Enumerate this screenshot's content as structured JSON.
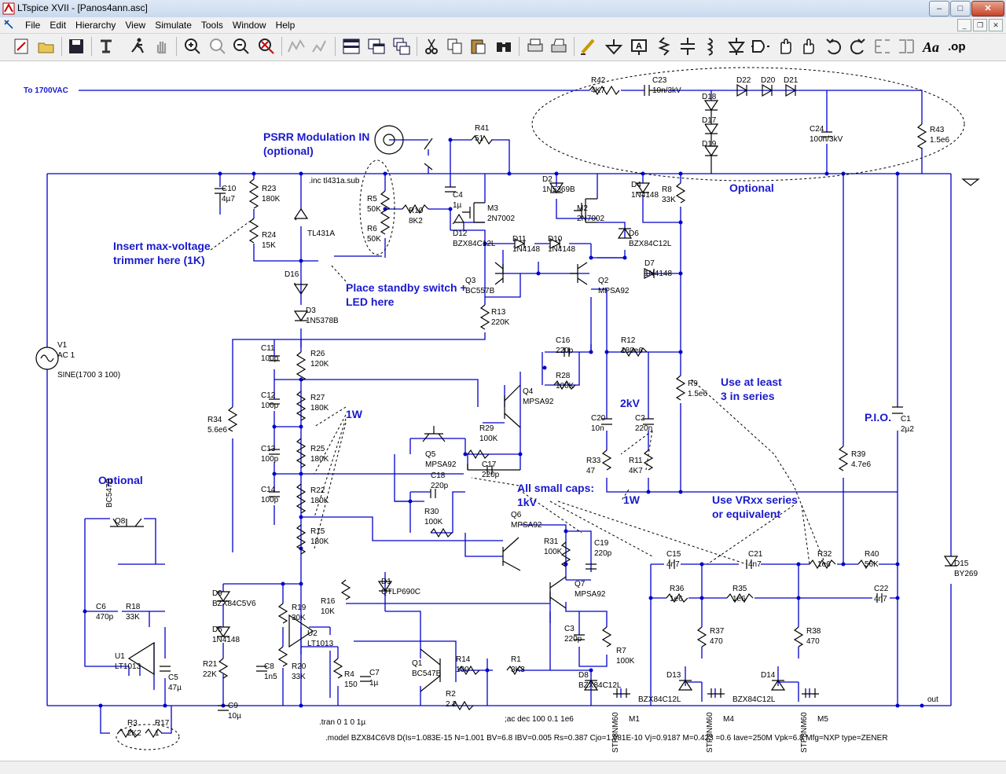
{
  "window": {
    "title": "LTspice XVII - [Panos4ann.asc]",
    "buttons": {
      "minimize": "–",
      "maximize": "□",
      "close": "✕"
    },
    "mdi_buttons": {
      "minimize": "_",
      "restore": "❐",
      "close": "✕"
    }
  },
  "menu": [
    "File",
    "Edit",
    "Hierarchy",
    "View",
    "Simulate",
    "Tools",
    "Window",
    "Help"
  ],
  "toolbar_icons": [
    "new-schematic-icon",
    "open-icon",
    "save-icon",
    "control-panel-icon",
    "run-icon",
    "halt-icon",
    "zoom-in-icon",
    "zoom-pan-icon",
    "zoom-out-icon",
    "zoom-fit-icon",
    "autorange-icon",
    "grid-icon",
    "tile-vertical-icon",
    "tile-horizontal-icon",
    "cascade-icon",
    "cut-icon",
    "copy-icon",
    "paste-icon",
    "find-icon",
    "print-preview-icon",
    "print-icon",
    "draw-wire-icon",
    "ground-icon",
    "label-net-icon",
    "resistor-icon",
    "capacitor-icon",
    "inductor-icon",
    "diode-icon",
    "component-icon",
    "move-icon",
    "drag-icon",
    "undo-icon",
    "redo-icon",
    "rotate-icon",
    "mirror-icon",
    "text-icon",
    "spice-directive-icon"
  ],
  "schematic": {
    "net_labels": [
      "To 1700VAC",
      "out"
    ],
    "directives": [
      ".inc tl431a.sub",
      ".tran 0 1 0 1µ",
      ";ac dec 100 0.1 1e6",
      ".model BZX84C6V8 D(Is=1.083E-15 N=1.001 BV=6.8 IBV=0.005 Rs=0.387 Cjo=1.981E-10 Vj=0.9187 M=0.423 =0.6 Iave=250M Vpk=6.8 Mfg=NXP type=ZENER"
    ],
    "comments": {
      "psrr_1": "PSRR Modulation IN",
      "psrr_2": "(optional)",
      "trimmer_1": "Insert max-voltage",
      "trimmer_2": "trimmer here (1K)",
      "standby_1": "Place standby switch +",
      "standby_2": "LED here",
      "optional_top": "Optional",
      "optional_left": "Optional",
      "series_1": "Use at least",
      "series_2": "3 in series",
      "kv2": "2kV",
      "w1_a": "1W",
      "w1_b": "1W",
      "smallcaps_1": "All small caps:",
      "smallcaps_2": "1kV",
      "pio": "P.I.O.",
      "vrxx_1": "Use VRxx series",
      "vrxx_2": "or equivalent"
    },
    "parts": [
      {
        "ref": "R42",
        "val": "4K7"
      },
      {
        "ref": "C23",
        "val": "10n/3kV"
      },
      {
        "ref": "D18",
        "val": ""
      },
      {
        "ref": "D22",
        "val": ""
      },
      {
        "ref": "D20",
        "val": ""
      },
      {
        "ref": "D21",
        "val": ""
      },
      {
        "ref": "D17",
        "val": ""
      },
      {
        "ref": "D19",
        "val": ""
      },
      {
        "ref": "C24",
        "val": "100n/3kV"
      },
      {
        "ref": "R43",
        "val": "1.5e6"
      },
      {
        "ref": "R41",
        "val": "51"
      },
      {
        "ref": "C10",
        "val": "4µ7"
      },
      {
        "ref": "R23",
        "val": "180K"
      },
      {
        "ref": "R24",
        "val": "15K"
      },
      {
        "ref": "TL431A",
        "val": ""
      },
      {
        "ref": "R5",
        "val": "50K"
      },
      {
        "ref": "R6",
        "val": "50K"
      },
      {
        "ref": "R10",
        "val": "8K2"
      },
      {
        "ref": "C4",
        "val": "1µ"
      },
      {
        "ref": "M3",
        "val": "2N7002"
      },
      {
        "ref": "D12",
        "val": "BZX84C12L"
      },
      {
        "ref": "D2",
        "val": "1N5369B"
      },
      {
        "ref": "M2",
        "val": "2N7002"
      },
      {
        "ref": "D4",
        "val": "1N4148"
      },
      {
        "ref": "R8",
        "val": "33K"
      },
      {
        "ref": "D6",
        "val": "BZX84C12L"
      },
      {
        "ref": "D11",
        "val": "1N4148"
      },
      {
        "ref": "D10",
        "val": "1N4148"
      },
      {
        "ref": "Q3",
        "val": "BC557B"
      },
      {
        "ref": "Q2",
        "val": "MPSA92"
      },
      {
        "ref": "D7",
        "val": "1N4148"
      },
      {
        "ref": "D16",
        "val": ""
      },
      {
        "ref": "D3",
        "val": "1N5378B"
      },
      {
        "ref": "R13",
        "val": "220K"
      },
      {
        "ref": "V1",
        "val": "AC 1"
      },
      {
        "ref": "V1_src",
        "val": "SINE(1700 3 100)"
      },
      {
        "ref": "C11",
        "val": "100p"
      },
      {
        "ref": "R26",
        "val": "120K"
      },
      {
        "ref": "C16",
        "val": "220p"
      },
      {
        "ref": "R12",
        "val": "180e6"
      },
      {
        "ref": "R28",
        "val": "100K"
      },
      {
        "ref": "Q4",
        "val": "MPSA92"
      },
      {
        "ref": "R9",
        "val": "1.5e6"
      },
      {
        "ref": "C12",
        "val": "100p"
      },
      {
        "ref": "R27",
        "val": "180K"
      },
      {
        "ref": "R34",
        "val": "5.6e6"
      },
      {
        "ref": "C20",
        "val": "10n"
      },
      {
        "ref": "C2",
        "val": "220n"
      },
      {
        "ref": "C1",
        "val": "2µ2"
      },
      {
        "ref": "Q5",
        "val": "MPSA92"
      },
      {
        "ref": "R29",
        "val": "100K"
      },
      {
        "ref": "C13",
        "val": "100p"
      },
      {
        "ref": "R25",
        "val": "180K"
      },
      {
        "ref": "C17",
        "val": "220p"
      },
      {
        "ref": "R33",
        "val": "47"
      },
      {
        "ref": "R11",
        "val": "4K7"
      },
      {
        "ref": "R39",
        "val": "4.7e6"
      },
      {
        "ref": "C18",
        "val": "220p"
      },
      {
        "ref": "C14",
        "val": "100p"
      },
      {
        "ref": "R22",
        "val": "180K"
      },
      {
        "ref": "R30",
        "val": "100K"
      },
      {
        "ref": "Q6",
        "val": "MPSA92"
      },
      {
        "ref": "Q8",
        "val": "BC547B"
      },
      {
        "ref": "R15",
        "val": "180K"
      },
      {
        "ref": "R31",
        "val": "100K"
      },
      {
        "ref": "C19",
        "val": "220p"
      },
      {
        "ref": "C15",
        "val": "4n7"
      },
      {
        "ref": "C21",
        "val": "4n7"
      },
      {
        "ref": "R32",
        "val": "1e6"
      },
      {
        "ref": "R40",
        "val": "56K"
      },
      {
        "ref": "D15",
        "val": "BY269"
      },
      {
        "ref": "D9",
        "val": "BZX84C5V6"
      },
      {
        "ref": "D1",
        "val": "QTLP690C"
      },
      {
        "ref": "Q7",
        "val": "MPSA92"
      },
      {
        "ref": "R36",
        "val": "1e6"
      },
      {
        "ref": "R35",
        "val": "1e6"
      },
      {
        "ref": "C22",
        "val": "4n7"
      },
      {
        "ref": "C6",
        "val": "470p"
      },
      {
        "ref": "R18",
        "val": "33K"
      },
      {
        "ref": "R19",
        "val": "30K"
      },
      {
        "ref": "R16",
        "val": "10K"
      },
      {
        "ref": "D5",
        "val": "1N4148"
      },
      {
        "ref": "U2",
        "val": "LT1013"
      },
      {
        "ref": "U1",
        "val": "LT1013"
      },
      {
        "ref": "C8",
        "val": "1n5"
      },
      {
        "ref": "C3",
        "val": "220p"
      },
      {
        "ref": "R7",
        "val": "100K"
      },
      {
        "ref": "R37",
        "val": "470"
      },
      {
        "ref": "R38",
        "val": "470"
      },
      {
        "ref": "R21",
        "val": "22K"
      },
      {
        "ref": "R20",
        "val": "33K"
      },
      {
        "ref": "R4",
        "val": "150"
      },
      {
        "ref": "C7",
        "val": "1µ"
      },
      {
        "ref": "Q1",
        "val": "BC547B"
      },
      {
        "ref": "R14",
        "val": "100"
      },
      {
        "ref": "R1",
        "val": "3K3"
      },
      {
        "ref": "D13",
        "val": ""
      },
      {
        "ref": "D14",
        "val": ""
      },
      {
        "ref": "C5",
        "val": "47µ"
      },
      {
        "ref": "D8",
        "val": "BZX84C12L"
      },
      {
        "ref": "BZ13",
        "val": "BZX84C12L"
      },
      {
        "ref": "BZ14",
        "val": "BZX84C12L"
      },
      {
        "ref": "C9",
        "val": "10µ"
      },
      {
        "ref": "R2",
        "val": "2.2"
      },
      {
        "ref": "R3",
        "val": "2K2"
      },
      {
        "ref": "R17",
        "val": "1"
      },
      {
        "ref": "M1",
        "val": "STP8NM60"
      },
      {
        "ref": "M4",
        "val": "STP8NM60"
      },
      {
        "ref": "M5",
        "val": "STP8NM60"
      }
    ]
  },
  "colors": {
    "wire": "#0000cc",
    "component": "#000000",
    "comment": "#1a1acc",
    "canvas": "#ffffff"
  }
}
